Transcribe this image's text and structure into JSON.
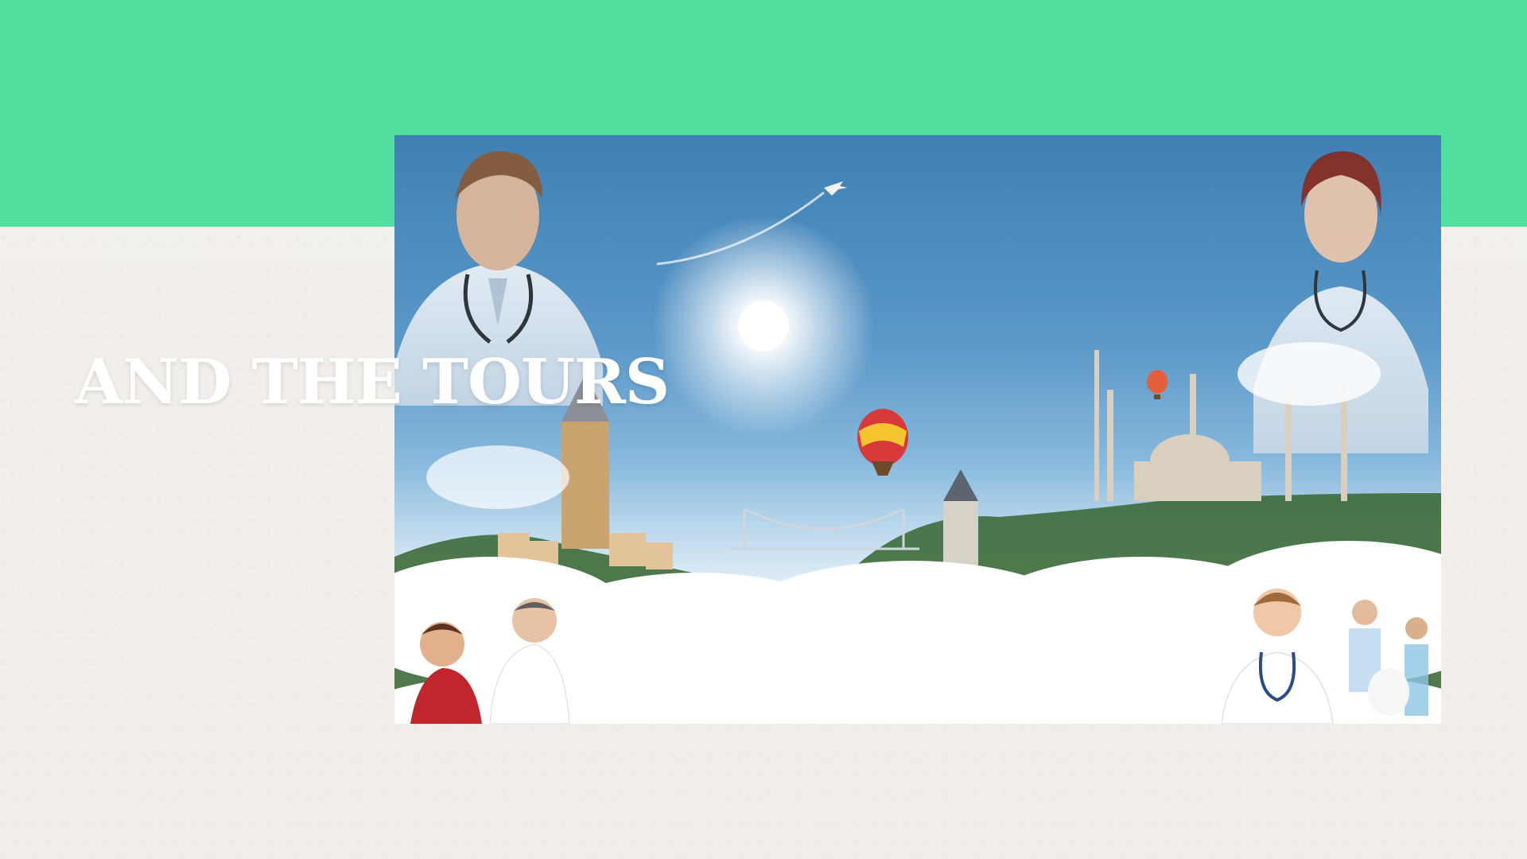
{
  "slide": {
    "title": "AND THE TOURS",
    "colors": {
      "band": "#52de9f",
      "background": "#f3f0ec",
      "title": "#ffffff",
      "sky": "#4f8cc0"
    }
  },
  "image": {
    "description_icon": "medical-tourism-collage-icon"
  }
}
